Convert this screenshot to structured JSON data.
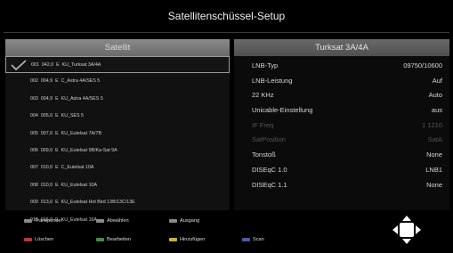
{
  "header": {
    "title": "Satellitenschüssel-Setup"
  },
  "left_panel": {
    "heading": "Satellit",
    "rows": [
      {
        "num": "001",
        "pos": "042,0",
        "dir": "E",
        "name": "KU_Turksat 3A/4A",
        "selected": true
      },
      {
        "num": "002",
        "pos": "004,9",
        "dir": "E",
        "name": "C_Astra 4A/SES 5"
      },
      {
        "num": "003",
        "pos": "004,9",
        "dir": "E",
        "name": "KU_Astra 4A/SES 5"
      },
      {
        "num": "004",
        "pos": "005,0",
        "dir": "E",
        "name": "KU_SES 5"
      },
      {
        "num": "005",
        "pos": "007,0",
        "dir": "E",
        "name": "KU_Eutelsat 7A/7B"
      },
      {
        "num": "006",
        "pos": "009,0",
        "dir": "E",
        "name": "KU_Eutelsat 9B/Ka-Sat 9A"
      },
      {
        "num": "007",
        "pos": "010,0",
        "dir": "E",
        "name": "C_Eutelsat 10A"
      },
      {
        "num": "008",
        "pos": "010,0",
        "dir": "E",
        "name": "KU_Eutelsat 10A"
      },
      {
        "num": "009",
        "pos": "013,0",
        "dir": "E",
        "name": "KU_Eutelsat Hot Bird 13B/13C/13E"
      },
      {
        "num": "010",
        "pos": "016,0",
        "dir": "E",
        "name": "KU_Eutelsat 16A"
      }
    ]
  },
  "right_panel": {
    "heading": "Turksat 3A/4A",
    "params": [
      {
        "label": "LNB-Typ",
        "value": "09750/10600",
        "dim": false
      },
      {
        "label": "LNB-Leistung",
        "value": "Auf",
        "dim": false
      },
      {
        "label": "22 KHz",
        "value": "Auto",
        "dim": false
      },
      {
        "label": "Unicable-Einstellung",
        "value": "aus",
        "dim": false
      },
      {
        "label": "IF Freq",
        "value": "1 1210",
        "dim": true
      },
      {
        "label": "SatPosition",
        "value": "SatA",
        "dim": true
      },
      {
        "label": "Tonstoß",
        "value": "None",
        "dim": false
      },
      {
        "label": "DISEqC 1.0",
        "value": "LNB1",
        "dim": false
      },
      {
        "label": "DISEqC 1.1",
        "value": "None",
        "dim": false
      }
    ]
  },
  "footer": {
    "transponder": "Transponder",
    "abwaehlen": "Abwählen",
    "ausgang": "Ausgang",
    "loeschen": "Löschen",
    "bearbeiten": "Bearbeiten",
    "hinzufuegen": "Hinzufügen",
    "scan": "Scan"
  },
  "colors": {
    "red": "#b43a3a",
    "green": "#4a8a4a",
    "yellow": "#c7b236",
    "blue": "#4b5b9c"
  }
}
